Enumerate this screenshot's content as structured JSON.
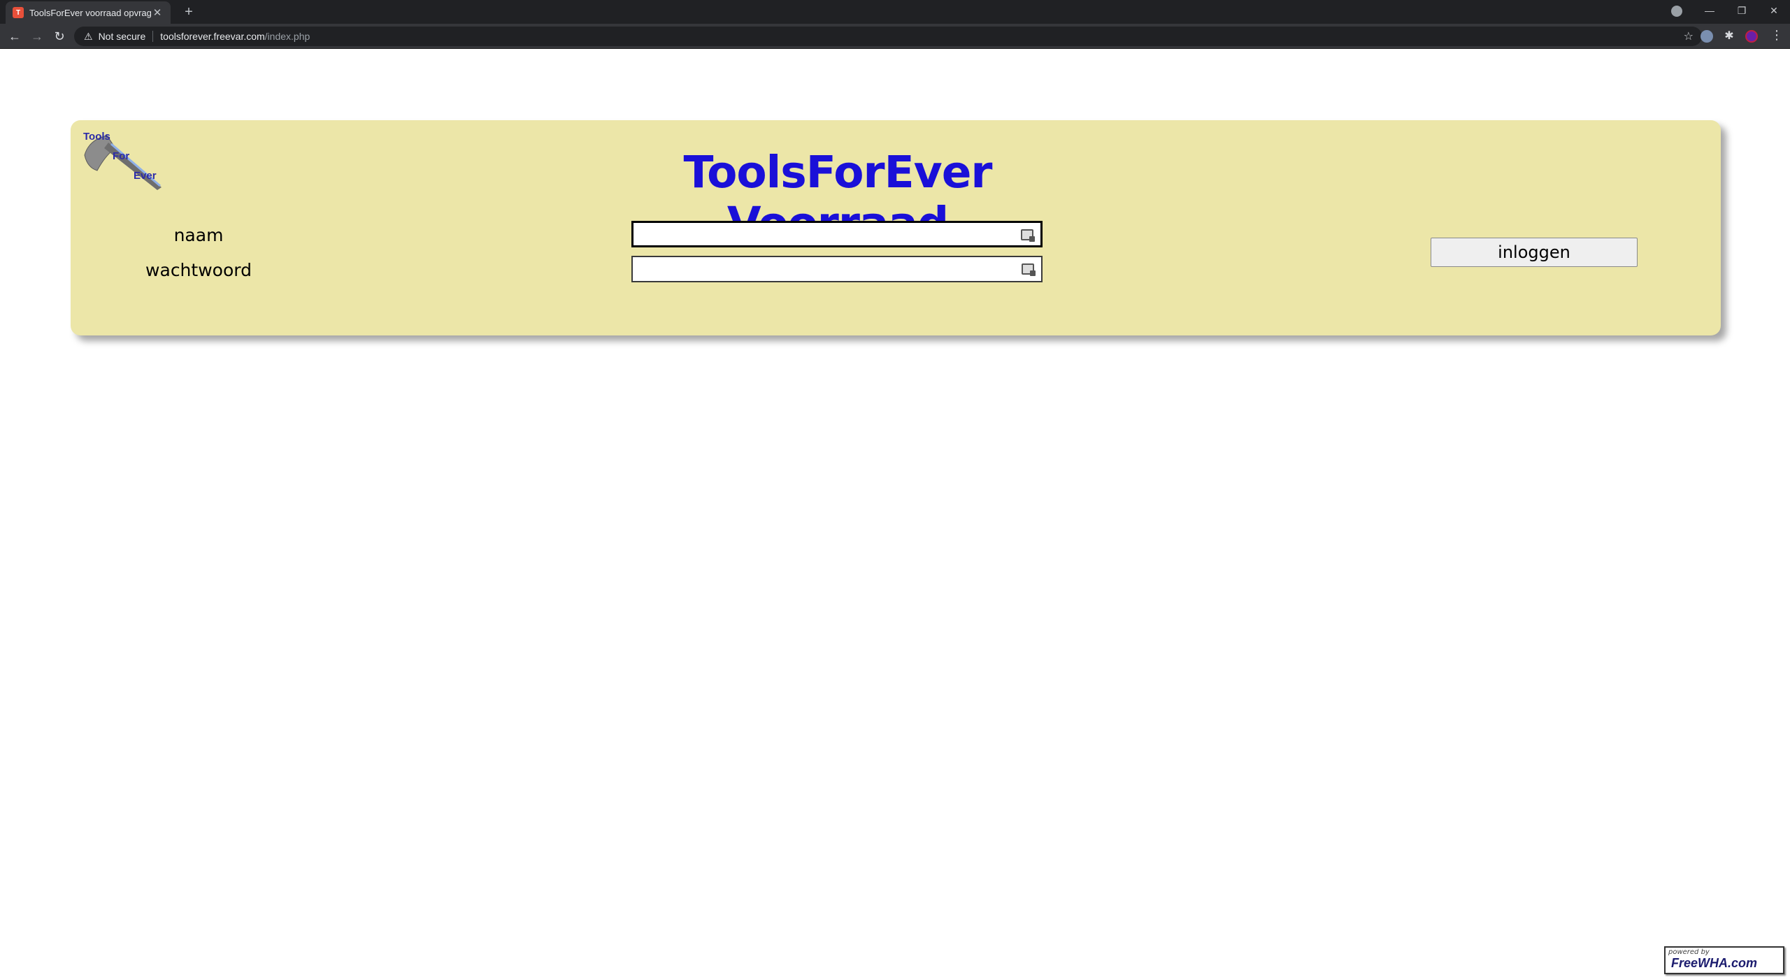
{
  "browser": {
    "tab_title": "ToolsForEver voorraad opvragen",
    "tab_close": "✕",
    "new_tab": "+",
    "security_label": "Not secure",
    "url_host": "toolsforever.freevar.com",
    "url_path": "/index.php",
    "icons": [
      "back-icon",
      "forward-icon",
      "reload-icon",
      "warning-icon",
      "star-icon",
      "extensions-icon",
      "menu-icon"
    ]
  },
  "page": {
    "title": "ToolsForEver Voorraad",
    "logo_text": [
      "Tools",
      "For",
      "Ever"
    ],
    "form": {
      "name_label": "naam",
      "password_label": "wachtwoord",
      "name_value": "",
      "password_value": "",
      "submit_label": "inloggen"
    },
    "colors": {
      "panel_background": "#ece6a8",
      "title_color": "#1a10d8"
    }
  },
  "footer_badge": {
    "small_text": "powered by",
    "main_text": "FreeWHA.com"
  }
}
